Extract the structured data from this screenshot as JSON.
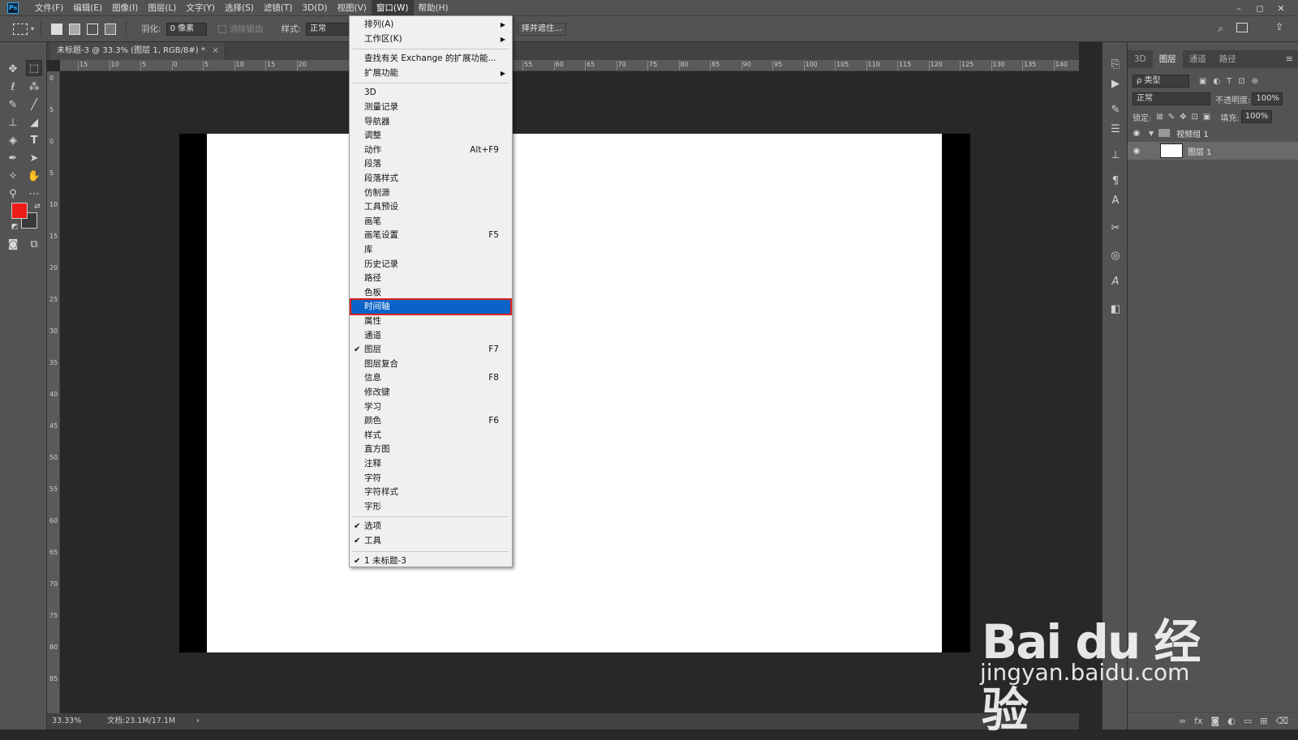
{
  "menubar": {
    "items": [
      "文件(F)",
      "编辑(E)",
      "图像(I)",
      "图层(L)",
      "文字(Y)",
      "选择(S)",
      "滤镜(T)",
      "3D(D)",
      "视图(V)",
      "窗口(W)",
      "帮助(H)"
    ],
    "active": "窗口(W)",
    "logo": "Ps"
  },
  "window_controls": [
    "–",
    "◻",
    "✕"
  ],
  "options_bar": {
    "feather_label": "羽化:",
    "feather_value": "0 像素",
    "antialias_label": "消除锯齿",
    "style_label": "样式:",
    "style_value": "正常",
    "select_mask_button": "择并遮住..."
  },
  "document": {
    "tab_title": "未标题-3 @ 33.3% (图层 1, RGB/8#) *",
    "close": "×"
  },
  "ruler": {
    "top": [
      "15",
      "10",
      "5",
      "0",
      "5",
      "10",
      "15",
      "20",
      "55",
      "60",
      "65",
      "70",
      "75",
      "80",
      "85",
      "90",
      "95",
      "100",
      "105",
      "110",
      "115",
      "120",
      "125",
      "130",
      "135",
      "140"
    ],
    "left": [
      "0",
      "5",
      "0",
      "5",
      "10",
      "15",
      "20",
      "25",
      "30",
      "35",
      "40",
      "45",
      "50",
      "55",
      "60",
      "65",
      "70",
      "75",
      "80",
      "85"
    ]
  },
  "status": {
    "zoom": "33.33%",
    "doc_size": "文档:23.1M/17.1M",
    "arrow": "›"
  },
  "window_menu": {
    "items": [
      {
        "label": "排列(A)",
        "submenu": true
      },
      {
        "label": "工作区(K)",
        "submenu": true
      },
      {
        "separator": true
      },
      {
        "label": "查找有关 Exchange 的扩展功能..."
      },
      {
        "label": "扩展功能",
        "submenu": true
      },
      {
        "separator": true
      },
      {
        "label": "3D"
      },
      {
        "label": "测量记录"
      },
      {
        "label": "导航器"
      },
      {
        "label": "调整"
      },
      {
        "label": "动作",
        "shortcut": "Alt+F9"
      },
      {
        "label": "段落"
      },
      {
        "label": "段落样式"
      },
      {
        "label": "仿制源"
      },
      {
        "label": "工具预设"
      },
      {
        "label": "画笔"
      },
      {
        "label": "画笔设置",
        "shortcut": "F5"
      },
      {
        "label": "库"
      },
      {
        "label": "历史记录"
      },
      {
        "label": "路径"
      },
      {
        "label": "色板"
      },
      {
        "label": "时间轴",
        "highlighted": true
      },
      {
        "label": "属性"
      },
      {
        "label": "通道"
      },
      {
        "label": "图层",
        "shortcut": "F7",
        "checked": true
      },
      {
        "label": "图层复合"
      },
      {
        "label": "信息",
        "shortcut": "F8"
      },
      {
        "label": "修改键"
      },
      {
        "label": "学习"
      },
      {
        "label": "颜色",
        "shortcut": "F6"
      },
      {
        "label": "样式"
      },
      {
        "label": "直方图"
      },
      {
        "label": "注释"
      },
      {
        "label": "字符"
      },
      {
        "label": "字符样式"
      },
      {
        "label": "字形"
      },
      {
        "separator": true
      },
      {
        "label": "选项",
        "checked": true
      },
      {
        "label": "工具",
        "checked": true
      },
      {
        "separator": true
      },
      {
        "label": "1 未标题-3",
        "checked": true
      }
    ],
    "checkmark": "✔",
    "submenu_arrow": "▶"
  },
  "layers_panel": {
    "tabs": [
      "3D",
      "图层",
      "通道",
      "路径"
    ],
    "active_tab": "图层",
    "filter_label": "ρ 类型",
    "blend_mode": "正常",
    "opacity_label": "不透明度:",
    "opacity_value": "100%",
    "lock_label": "锁定:",
    "fill_label": "填充:",
    "fill_value": "100%",
    "layers": [
      {
        "name": "视频组 1",
        "type": "group"
      },
      {
        "name": "图层 1",
        "type": "layer",
        "selected": true
      }
    ]
  },
  "watermark": {
    "brand": "Bai du 经验",
    "url": "jingyan.baidu.com"
  },
  "colors": {
    "foreground": "#ee1c18",
    "highlight": "#0a64c8",
    "highlight_border": "#e0201b"
  }
}
